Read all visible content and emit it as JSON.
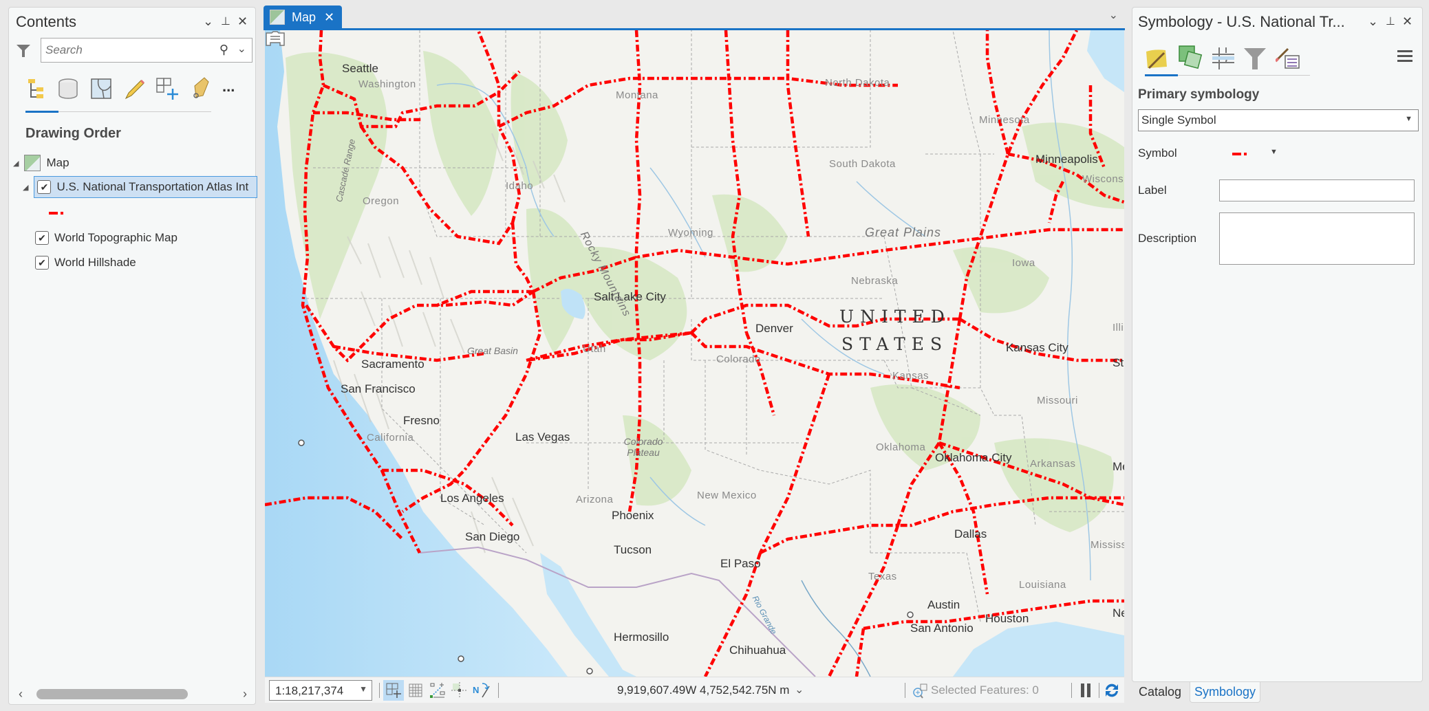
{
  "contents": {
    "title": "Contents",
    "search_placeholder": "Search",
    "drawing_order_label": "Drawing Order",
    "tools": [
      "list-by-drawing-order",
      "list-by-source",
      "list-by-selection",
      "list-by-editing",
      "list-by-snapping",
      "list-by-labeling",
      "more"
    ],
    "more_label": "...",
    "layers": [
      {
        "label": "Map",
        "type": "map",
        "expanded": true
      },
      {
        "label": "U.S. National Transportation Atlas Int",
        "checked": true,
        "selected": true,
        "expanded": true
      },
      {
        "label": "World Topographic Map",
        "checked": true
      },
      {
        "label": "World Hillshade",
        "checked": true
      }
    ]
  },
  "map": {
    "tab_label": "Map",
    "scale": "1:18,217,374",
    "coordinates": "9,919,607.49W 4,752,542.75N m",
    "selected_features": "Selected Features: 0",
    "route_color": "#ff0000",
    "labels": {
      "cities": [
        "Seattle",
        "Minneapolis",
        "Salt Lake City",
        "Denver",
        "Kansas City",
        "Sacramento",
        "San Francisco",
        "Fresno",
        "Las Vegas",
        "Los Angeles",
        "San Diego",
        "Phoenix",
        "Tucson",
        "El Paso",
        "Oklahoma City",
        "Dallas",
        "Austin",
        "San Antonio",
        "Houston",
        "Hermosillo",
        "Chihuahua",
        "St",
        "Me",
        "Ne"
      ],
      "states": [
        "Washington",
        "Montana",
        "North Dakota",
        "Minnesota",
        "South Dakota",
        "Wisconsin",
        "Oregon",
        "Idaho",
        "Wyoming",
        "Nebraska",
        "Iowa",
        "Utah",
        "Colorado",
        "Kansas",
        "Missouri",
        "Illinois",
        "California",
        "Arizona",
        "New Mexico",
        "Oklahoma",
        "Arkansas",
        "Texas",
        "Louisiana",
        "Mississippi"
      ],
      "regions": [
        "Great Plains",
        "Rocky Mountains",
        "Cascade Range",
        "Great Basin",
        "Colorado Plateau"
      ],
      "country": [
        "UNITED",
        "STATES"
      ],
      "rivers": [
        "Rio Grande"
      ]
    }
  },
  "symbology": {
    "title": "Symbology - U.S. National Tr...",
    "primary_label": "Primary symbology",
    "primary_value": "Single Symbol",
    "symbol_label": "Symbol",
    "label_label": "Label",
    "label_value": "",
    "description_label": "Description",
    "description_value": ""
  },
  "bottom_tabs": [
    {
      "label": "Catalog",
      "active": false
    },
    {
      "label": "Symbology",
      "active": true
    }
  ]
}
